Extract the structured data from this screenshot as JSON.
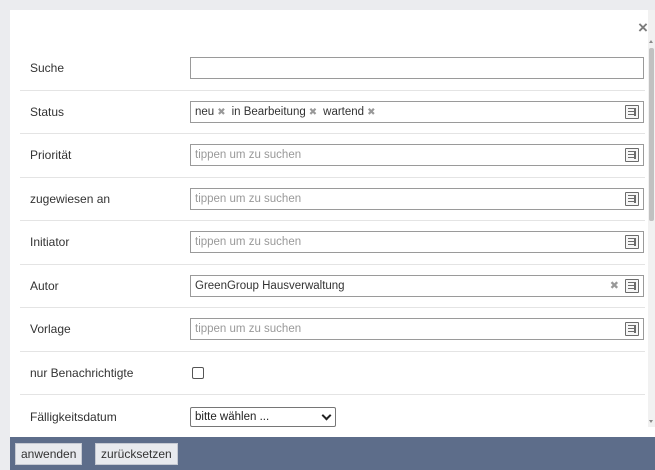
{
  "dialog": {
    "close_icon": "close-icon"
  },
  "fields": {
    "suche": {
      "label": "Suche",
      "value": ""
    },
    "status": {
      "label": "Status",
      "tags": [
        "neu",
        "in Bearbeitung",
        "wartend"
      ],
      "remove_glyph": "✖"
    },
    "prioritaet": {
      "label": "Priorität",
      "placeholder": "tippen um zu suchen"
    },
    "zugewiesen": {
      "label": "zugewiesen an",
      "placeholder": "tippen um zu suchen"
    },
    "initiator": {
      "label": "Initiator",
      "placeholder": "tippen um zu suchen"
    },
    "autor": {
      "label": "Autor",
      "value": "GreenGroup Hausverwaltung",
      "clear_glyph": "✖"
    },
    "vorlage": {
      "label": "Vorlage",
      "placeholder": "tippen um zu suchen"
    },
    "benachrichtigte": {
      "label": "nur Benachrichtigte",
      "checked": false
    },
    "faelligkeit": {
      "label": "Fälligkeitsdatum",
      "selected": "bitte wählen ..."
    }
  },
  "footer": {
    "apply_label": "anwenden",
    "reset_label": "zurücksetzen"
  },
  "colors": {
    "footer_bg": "#5d6d8a",
    "page_bg": "#ebecef"
  }
}
